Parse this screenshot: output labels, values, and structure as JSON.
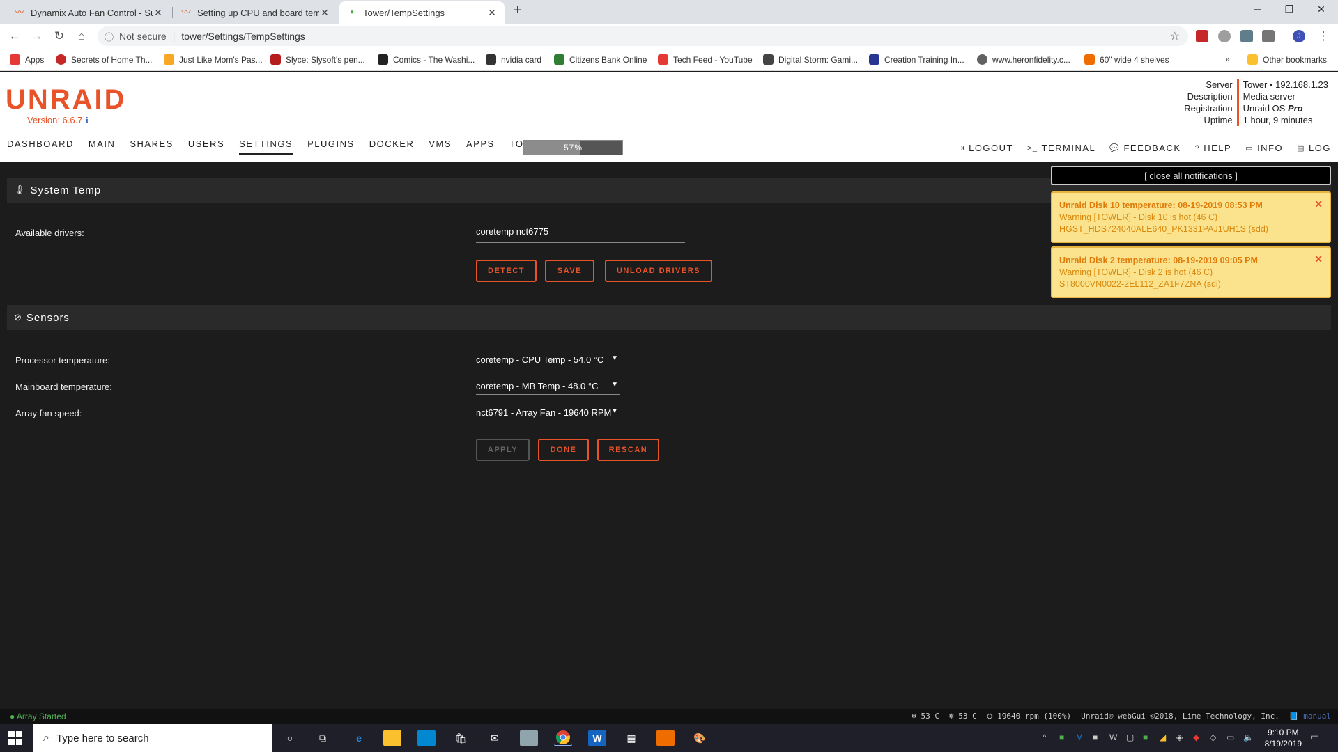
{
  "browser": {
    "tabs": [
      {
        "title": "Dynamix Auto Fan Control - Sudo",
        "active": false
      },
      {
        "title": "Setting up CPU and board tempe",
        "active": false
      },
      {
        "title": "Tower/TempSettings",
        "active": true
      }
    ],
    "security": "Not secure",
    "url": "tower/Settings/TempSettings",
    "bookmarks": [
      "Apps",
      "Secrets of Home Th...",
      "Just Like Mom's Pas...",
      "Slyce: Slysoft's pen...",
      "Comics - The Washi...",
      "nvidia card",
      "Citizens Bank Online",
      "Tech Feed - YouTube",
      "Digital Storm: Gami...",
      "Creation Training In...",
      "www.heronfidelity.c...",
      "60\" wide 4 shelves"
    ],
    "other_bookmarks": "Other bookmarks",
    "profile_initial": "J"
  },
  "unraid": {
    "logo": "UNRAID",
    "version": "Version: 6.6.7",
    "server_keys": [
      "Server",
      "Description",
      "Registration",
      "Uptime"
    ],
    "server_vals": {
      "server": "Tower • 192.168.1.23",
      "description": "Media server",
      "registration_prefix": "Unraid OS ",
      "registration_tier": "Pro",
      "uptime": "1 hour, 9 minutes"
    },
    "nav": [
      "DASHBOARD",
      "MAIN",
      "SHARES",
      "USERS",
      "SETTINGS",
      "PLUGINS",
      "DOCKER",
      "VMS",
      "APPS",
      "TOOLS"
    ],
    "active_nav": "SETTINGS",
    "progress": {
      "label": "57%",
      "value": 0.57
    },
    "right_nav": [
      "LOGOUT",
      "TERMINAL",
      "FEEDBACK",
      "HELP",
      "INFO",
      "LOG"
    ]
  },
  "system_temp": {
    "title": "System Temp",
    "drivers_label": "Available drivers:",
    "drivers_value": "coretemp nct6775",
    "buttons": [
      "DETECT",
      "SAVE",
      "UNLOAD DRIVERS"
    ]
  },
  "sensors": {
    "title": "Sensors",
    "rows": [
      {
        "label": "Processor temperature:",
        "value": "coretemp - CPU Temp - 54.0 °C"
      },
      {
        "label": "Mainboard temperature:",
        "value": "coretemp - MB Temp - 48.0 °C"
      },
      {
        "label": "Array fan speed:",
        "value": "nct6791 - Array Fan - 19640 RPM"
      }
    ],
    "buttons": [
      "APPLY",
      "DONE",
      "RESCAN"
    ]
  },
  "notifications": {
    "close_all": "[ close all notifications ]",
    "items": [
      {
        "title": "Unraid Disk 10 temperature: 08-19-2019 08:53 PM",
        "line1": "Warning [TOWER] - Disk 10 is hot (46 C)",
        "line2": "HGST_HDS724040ALE640_PK1331PAJ1UH1S (sdd)"
      },
      {
        "title": "Unraid Disk 2 temperature: 08-19-2019 09:05 PM",
        "line1": "Warning [TOWER] - Disk 2 is hot (46 C)",
        "line2": "ST8000VN0022-2EL112_ZA1F7ZNA (sdi)"
      }
    ]
  },
  "footer": {
    "status": "Array Started",
    "cpu_temp": "53 C",
    "mb_temp": "53 C",
    "fan": "19640 rpm (100%)",
    "copyright": "Unraid® webGui ©2018, Lime Technology, Inc.",
    "manual": "manual"
  },
  "taskbar": {
    "search_placeholder": "Type here to search",
    "time": "9:10 PM",
    "date": "8/19/2019"
  },
  "colors": {
    "accent": "#e8532a",
    "notification_bg": "#fbe38e",
    "array_started": "#4caf50"
  }
}
